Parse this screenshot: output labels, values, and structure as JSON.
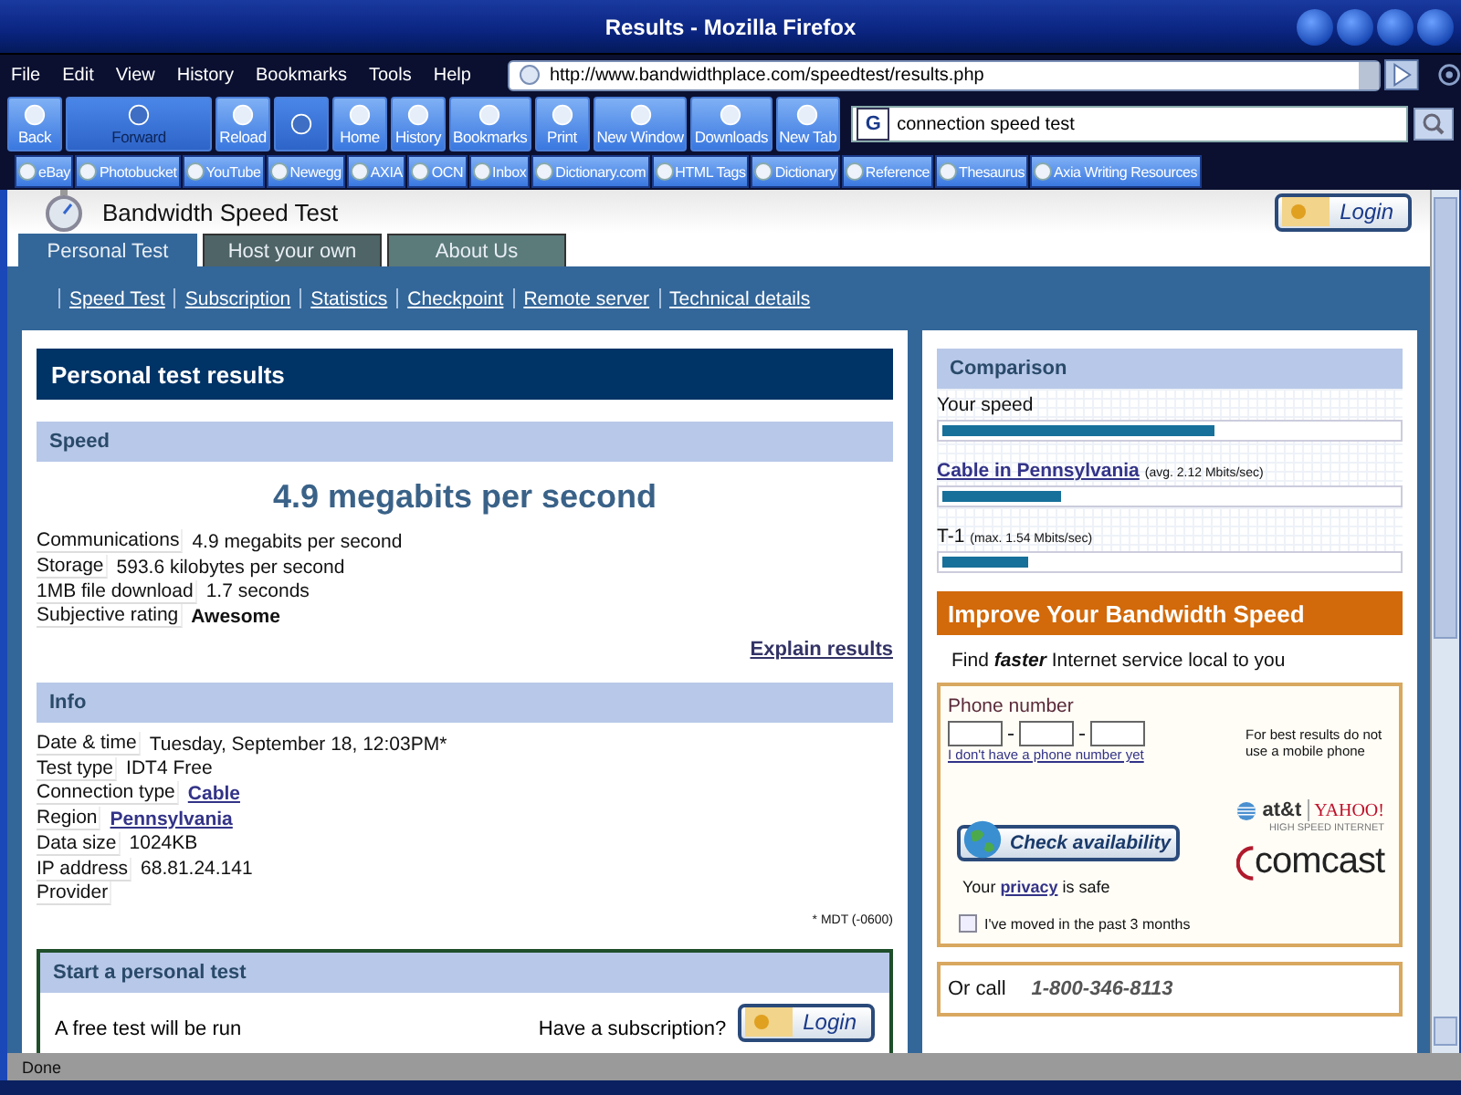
{
  "window": {
    "title": "Results - Mozilla Firefox"
  },
  "menu": [
    "File",
    "Edit",
    "View",
    "History",
    "Bookmarks",
    "Tools",
    "Help"
  ],
  "address_bar": {
    "value": "http://www.bandwidthplace.com/speedtest/results.php"
  },
  "toolbar": [
    {
      "label": "Back",
      "disabled": false
    },
    {
      "label": "Forward",
      "disabled": true
    },
    {
      "label": "Reload",
      "disabled": false
    },
    {
      "disabled": true
    },
    {
      "label": "Home",
      "disabled": false
    },
    {
      "label": "History",
      "disabled": false
    },
    {
      "label": "Bookmarks",
      "disabled": false
    },
    {
      "label": "Print",
      "disabled": false
    },
    {
      "label": "New Window",
      "disabled": false
    },
    {
      "label": "Downloads",
      "disabled": false
    },
    {
      "label": "New Tab",
      "disabled": false
    }
  ],
  "search": {
    "engine": "G",
    "value": "connection speed test"
  },
  "bookmarks": [
    "eBay",
    "Photobucket",
    "YouTube",
    "Newegg",
    "AXIA",
    "OCN",
    "Inbox",
    "Dictionary.com",
    "HTML Tags",
    "Dictionary",
    "Reference",
    "Thesaurus",
    "Axia Writing Resources"
  ],
  "page": {
    "site_title": "Bandwidth Speed Test",
    "login": "Login",
    "tabs": [
      {
        "label": "Personal Test",
        "selected": true
      },
      {
        "label": "Host your own",
        "selected": false
      },
      {
        "label": "About Us",
        "selected": false
      }
    ],
    "links": [
      "Speed Test",
      "Subscription",
      "Statistics",
      "Checkpoint",
      "Remote server",
      "Technical details"
    ],
    "results": {
      "heading": "Personal test results",
      "speed": {
        "heading": "Speed",
        "headline": "4.9 megabits per second",
        "rows": [
          {
            "label": "Communications",
            "value": "4.9 megabits per second",
            "kind": "text"
          },
          {
            "label": "Storage",
            "value": "593.6 kilobytes per second",
            "kind": "text"
          },
          {
            "label": "1MB file download",
            "value": "1.7 seconds",
            "kind": "text"
          },
          {
            "label": "Subjective rating",
            "value": "Awesome",
            "kind": "bold"
          }
        ],
        "explain": "Explain results"
      },
      "info": {
        "heading": "Info",
        "rows": [
          {
            "label": "Date & time",
            "value": "Tuesday, September 18, 12:03PM*",
            "kind": "text"
          },
          {
            "label": "Test type",
            "value": "IDT4 Free",
            "kind": "text"
          },
          {
            "label": "Connection type",
            "value": "Cable",
            "kind": "link"
          },
          {
            "label": "Region",
            "value": "Pennsylvania",
            "kind": "link"
          },
          {
            "label": "Data size",
            "value": "1024KB",
            "kind": "text"
          },
          {
            "label": "IP address",
            "value": "68.81.24.141",
            "kind": "text"
          },
          {
            "label": "Provider"
          }
        ],
        "footnote": "* MDT (-0600)"
      },
      "start": {
        "heading": "Start a personal test",
        "text": "A free test will be run",
        "subscription": "Have a subscription?",
        "login": "Login"
      }
    },
    "comparison": {
      "heading": "Comparison",
      "bars": [
        {
          "label": "Your speed",
          "kind": "text",
          "level": 0.6
        },
        {
          "label": "Cable in Pennsylvania",
          "note": "(avg. 2.12 Mbits/sec)",
          "kind": "link",
          "level": 0.26
        },
        {
          "label": "T-1",
          "note": "(max. 1.54 Mbits/sec)",
          "kind": "text",
          "level": 0.19
        }
      ]
    },
    "improve": {
      "heading": "Improve Your Bandwidth Speed",
      "tagline": "Find **faster** Internet service local to you",
      "phone_label": "Phone number",
      "no_phone": "I don't have a phone number yet",
      "note": "For best results do not use a mobile phone",
      "check": "Check availability",
      "privacy_prefix": "Your",
      "privacy_link": "privacy",
      "privacy_suffix": "is safe",
      "att": "at&t",
      "yahoo": "YAHOO!",
      "high_speed": "HIGH SPEED INTERNET",
      "comcast": "comcast",
      "moved": {
        "label": "I've moved in the past 3 months",
        "checked": false
      },
      "call": "Or call",
      "phone": "1-800-346-8113"
    }
  },
  "status": "Done"
}
